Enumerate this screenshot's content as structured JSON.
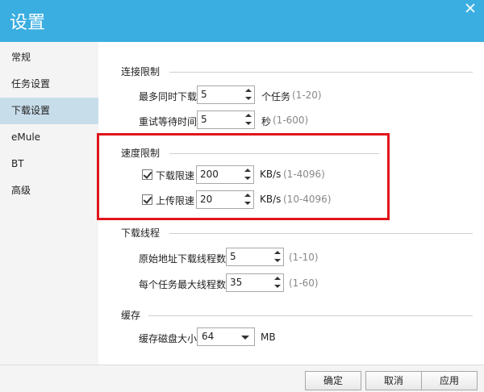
{
  "window": {
    "title": "设置"
  },
  "sidebar": {
    "items": [
      "常规",
      "任务设置",
      "下载设置",
      "eMule",
      "BT",
      "高级"
    ]
  },
  "connection": {
    "section_title": "连接限制",
    "max_downloads": {
      "label": "最多同时下载",
      "value": "5",
      "unit": "个任务",
      "hint": "(1-20)"
    },
    "retry_wait": {
      "label": "重试等待时间",
      "value": "5",
      "unit": "秒",
      "hint": "(1-600)"
    }
  },
  "speed": {
    "section_title": "速度限制",
    "download": {
      "label": "下载限速",
      "value": "200",
      "unit": "KB/s",
      "hint": "(1-4096)",
      "checked": true
    },
    "upload": {
      "label": "上传限速",
      "value": "20",
      "unit": "KB/s",
      "hint": "(10-4096)",
      "checked": true
    }
  },
  "threads": {
    "section_title": "下载线程",
    "origin": {
      "label": "原始地址下载线程数",
      "value": "5",
      "hint": "(1-10)"
    },
    "per_task": {
      "label": "每个任务最大线程数",
      "value": "35",
      "hint": "(1-60)"
    }
  },
  "cache": {
    "section_title": "缓存",
    "size": {
      "label": "缓存磁盘大小",
      "value": "64",
      "unit": "MB"
    }
  },
  "footer": {
    "ok": "确定",
    "cancel": "取消",
    "apply": "应用"
  },
  "colors": {
    "titlebar": "#3aaee0",
    "highlight": "#e0151b",
    "active_item": "#c8ddea"
  }
}
